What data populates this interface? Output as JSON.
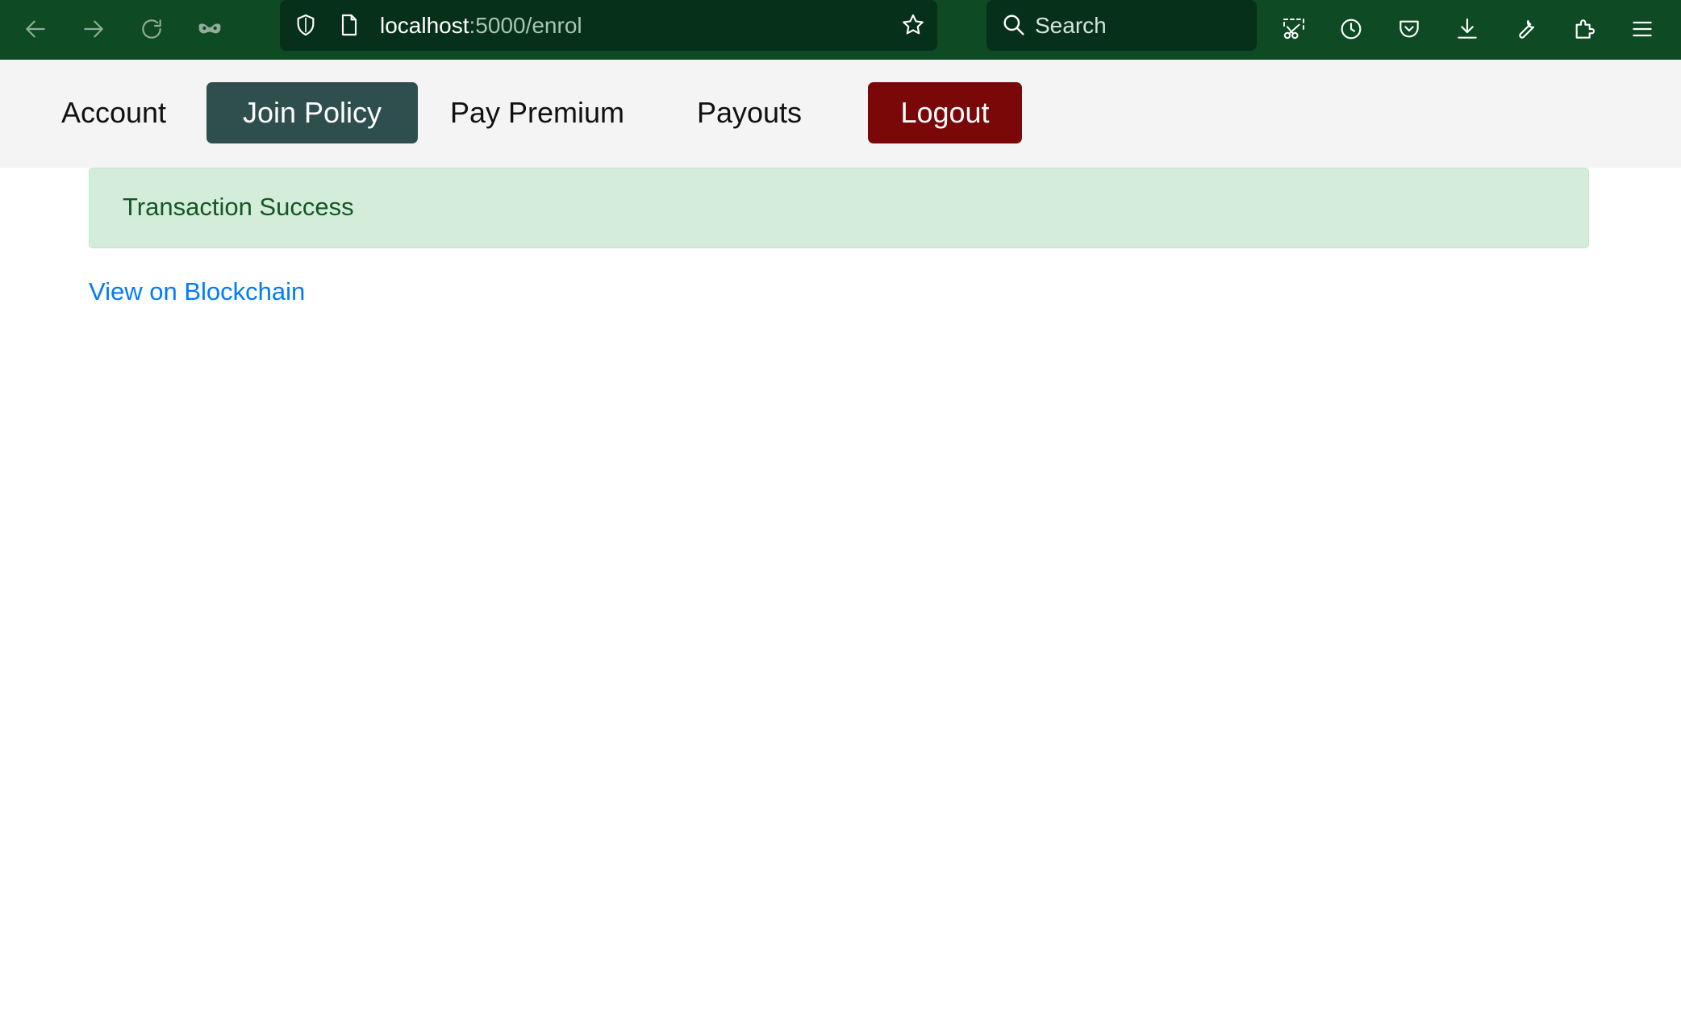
{
  "browser": {
    "url_host": "localhost",
    "url_path": ":5000/enrol",
    "search_placeholder": "Search",
    "nav_icons": [
      "back-icon",
      "forward-icon",
      "reload-icon",
      "private-mask-icon"
    ],
    "toolbar_icons": [
      "screenshot-icon",
      "history-icon",
      "pocket-icon",
      "download-icon",
      "tools-wrench-icon",
      "extensions-icon",
      "menu-icon"
    ],
    "colors": {
      "toolbar_bg": "#0e4a24",
      "urlbar_bg": "#06301a"
    }
  },
  "navbar": {
    "items": [
      {
        "label": "Account"
      },
      {
        "label": "Join Policy"
      },
      {
        "label": "Pay Premium"
      },
      {
        "label": "Payouts"
      }
    ],
    "logout_label": "Logout",
    "colors": {
      "active_bg": "#2f4f4f",
      "logout_bg": "#7b0808"
    }
  },
  "main": {
    "alert_text": "Transaction Success",
    "link_text": "View on Blockchain",
    "colors": {
      "alert_bg": "#d4edda",
      "alert_text": "#155724",
      "link": "#007bff"
    }
  }
}
